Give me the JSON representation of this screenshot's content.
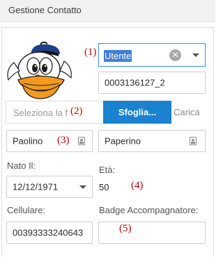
{
  "header": {
    "title": "Gestione Contatto"
  },
  "markers": {
    "m1": "(1)",
    "m2": "(2)",
    "m3": "(3)",
    "m4": "(4)",
    "m5": "(5)"
  },
  "contact_type": {
    "value": "Utente",
    "clear_icon": "close-circle-icon",
    "dropdown_icon": "chevron-down-icon"
  },
  "code_field": {
    "value": "0003136127_2"
  },
  "upload": {
    "placeholder": "Seleziona la f",
    "browse_label": "Sfoglia...",
    "upload_label": "Carica",
    "accent": "#1a82d0"
  },
  "first_name": {
    "value": "Paolino",
    "icon": "id-card-icon"
  },
  "last_name": {
    "value": "Paperino",
    "icon": "id-card-icon"
  },
  "birth_date": {
    "label": "Nato Il:",
    "value": "12/12/1971"
  },
  "age": {
    "label": "Età:",
    "value": "50"
  },
  "phone": {
    "label": "Cellulare:",
    "value": "00393333240643"
  },
  "badge": {
    "label": "Badge Accompagnatore:",
    "value": ""
  },
  "colors": {
    "focus_border": "#3a8ee6",
    "selection_bg": "#3f7fd9",
    "marker": "#c00000"
  }
}
